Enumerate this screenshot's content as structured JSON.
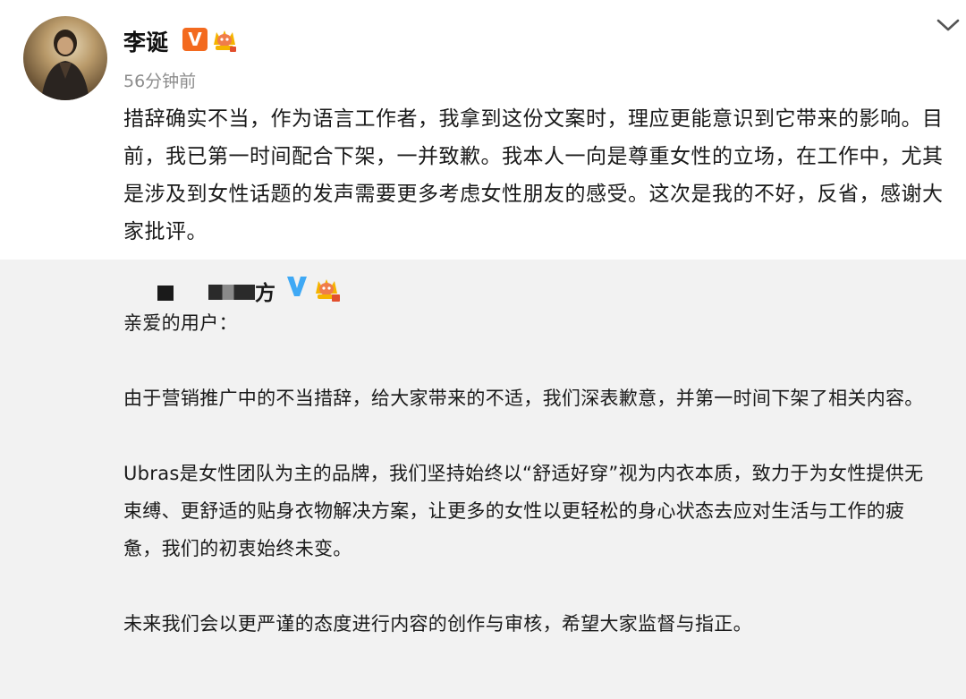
{
  "post": {
    "author": "李诞",
    "time": "56分钟前",
    "verified_badge": "V",
    "text": "措辞确实不当，作为语言工作者，我拿到这份文案时，理应更能意识到它带来的影响。目前，我已第一时间配合下架，一并致歉。我本人一向是尊重女性的立场，在工作中，尤其是涉及到女性话题的发声需要更多考虑女性朋友的感受。这次是我的不好，反省，感谢大家批评。"
  },
  "repost": {
    "account_name_suffix": "方",
    "salutation": "亲爱的用户：",
    "paragraphs": [
      "由于营销推广中的不当措辞，给大家带来的不适，我们深表歉意，并第一时间下架了相关内容。",
      "Ubras是女性团队为主的品牌，我们坚持始终以“舒适好穿”视为内衣本质，致力于为女性提供无束缚、更舒适的贴身衣物解决方案，让更多的女性以更轻松的身心状态去应对生活与工作的疲惫，我们的初衷始终未变。",
      "未来我们会以更严谨的态度进行内容的创作与审核，希望大家监督与指正。"
    ]
  },
  "icons": {
    "avatar": "avatar-photo",
    "verified": "orange-v-badge",
    "crown": "crown-badge",
    "blue_verified": "blue-v-badge",
    "menu": "chevron-down-icon"
  },
  "colors": {
    "background": "#ffffff",
    "repost_background": "#f2f2f2",
    "text": "#1a1a1a",
    "time": "#8c8c8c",
    "orange_badge": "#f36a1f",
    "blue_badge": "#3fa9f5"
  }
}
